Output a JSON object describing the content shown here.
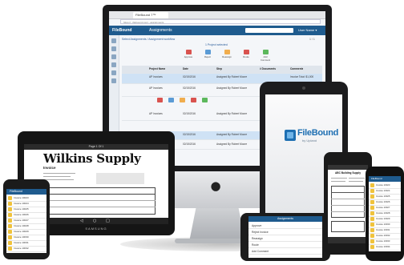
{
  "imac": {
    "tab_title": "FileBound 7™",
    "url": "https://...filebound.com/...assignments",
    "app_logo": "FileBound",
    "page_title": "Assignments",
    "user": "User Name ▾",
    "breadcrumb": "Select Assignments / Assignment workflow",
    "pager": "1 / 1",
    "item_count": "1 Project selected",
    "toolbar": [
      {
        "label": "Approve",
        "color": "#d9534f"
      },
      {
        "label": "Reject",
        "color": "#5b9bd5"
      },
      {
        "label": "Reassign",
        "color": "#f0ad4e"
      },
      {
        "label": "Route",
        "color": "#d9534f"
      },
      {
        "label": "Add Comment",
        "color": "#5cb85c"
      }
    ],
    "table": {
      "headers": [
        "",
        "Project Name",
        "Date",
        "Step",
        "# Documents",
        "Comments"
      ],
      "rows": [
        {
          "name": "AP Invoices",
          "date": "02/15/2016",
          "step": "Assigned By Robert Moore",
          "comment": "Invoice Total: $1,000"
        },
        {
          "name": "AP Invoices",
          "date": "02/15/2016",
          "step": "Assigned By Robert Moore",
          "comment": ""
        },
        {
          "name": "AP Invoices",
          "date": "02/15/2016",
          "step": "Assigned By Robert Moore",
          "comment": ""
        },
        {
          "name": "AP Invoices",
          "date": "02/15/2016",
          "step": "Assigned By Robert Moore",
          "comment": ""
        },
        {
          "name": "AP Invoices",
          "date": "02/15/2016",
          "step": "Assigned By Robert Moore",
          "comment": ""
        }
      ]
    }
  },
  "tablet": {
    "viewer_title": "Page 1 Of 1",
    "company": "Wilkins Supply",
    "doc_type": "Invoice",
    "brand": "SAMSUNG",
    "nav_back": "◁",
    "nav_home": "○",
    "nav_recent": "□"
  },
  "ipad": {
    "brand": "FileBound",
    "tagline": "by Upland"
  },
  "phone_left": {
    "title": "FileBound",
    "rows": [
      "Invoice 10023",
      "Invoice 10024",
      "Invoice 10025",
      "Invoice 10026",
      "Invoice 10027",
      "Invoice 10028",
      "Invoice 10029",
      "Invoice 10030",
      "Invoice 10031",
      "Invoice 10032"
    ]
  },
  "phone_landscape": {
    "title": "Assignments",
    "rows": [
      "Approve",
      "Reject Invoice",
      "Reassign",
      "Route",
      "Add Comment"
    ]
  },
  "phone_mid": {
    "doc_title": "ABC Building Supply"
  },
  "phone_right": {
    "title": "FileBound",
    "rows": [
      "Invoice 10023",
      "Invoice 10024",
      "Invoice 10025",
      "Invoice 10026",
      "Invoice 10027",
      "Invoice 10028",
      "Invoice 10029",
      "Invoice 10030",
      "Invoice 10031",
      "Invoice 10032",
      "Invoice 10033",
      "Invoice 10034"
    ]
  }
}
